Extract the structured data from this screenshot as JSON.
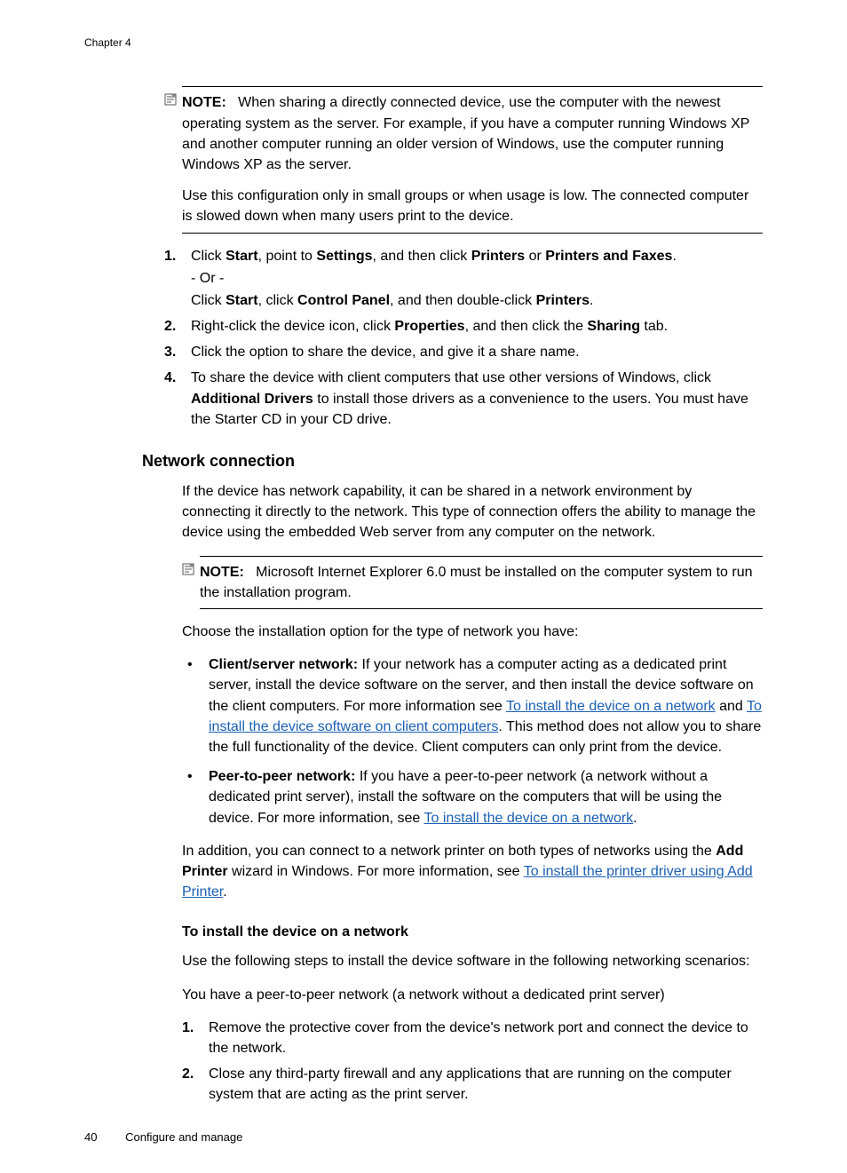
{
  "chapter": "Chapter 4",
  "note1": {
    "label": "NOTE:",
    "p1": "When sharing a directly connected device, use the computer with the newest operating system as the server. For example, if you have a computer running Windows XP and another computer running an older version of Windows, use the computer running Windows XP as the server.",
    "p2": "Use this configuration only in small groups or when usage is low. The connected computer is slowed down when many users print to the device."
  },
  "list1": {
    "i1a": "Click ",
    "i1b": "Start",
    "i1c": ", point to ",
    "i1d": "Settings",
    "i1e": ", and then click ",
    "i1f": "Printers",
    "i1g": " or ",
    "i1h": "Printers and Faxes",
    "i1i": ".",
    "i1or": "- Or -",
    "i1j": "Click ",
    "i1k": "Start",
    "i1l": ", click ",
    "i1m": "Control Panel",
    "i1n": ", and then double-click ",
    "i1o": "Printers",
    "i1p": ".",
    "i2a": "Right-click the device icon, click ",
    "i2b": "Properties",
    "i2c": ", and then click the ",
    "i2d": "Sharing",
    "i2e": " tab.",
    "i3": "Click the option to share the device, and give it a share name.",
    "i4a": "To share the device with client computers that use other versions of Windows, click ",
    "i4b": "Additional Drivers",
    "i4c": " to install those drivers as a convenience to the users. You must have the Starter CD in your CD drive."
  },
  "heading": "Network connection",
  "netIntro": "If the device has network capability, it can be shared in a network environment by connecting it directly to the network. This type of connection offers the ability to manage the device using the embedded Web server from any computer on the network.",
  "note2": {
    "label": "NOTE:",
    "p1": "Microsoft Internet Explorer 6.0 must be installed on the computer system to run the installation program."
  },
  "chooseLine": "Choose the installation option for the type of network you have:",
  "bullets": {
    "b1a": "Client/server network:",
    "b1b": " If your network has a computer acting as a dedicated print server, install the device software on the server, and then install the device software on the client computers. For more information see ",
    "b1link1": "To install the device on a network",
    "b1c": " and ",
    "b1link2": "To install the device software on client computers",
    "b1d": ". This method does not allow you to share the full functionality of the device. Client computers can only print from the device.",
    "b2a": "Peer-to-peer network:",
    "b2b": " If you have a peer-to-peer network (a network without a dedicated print server), install the software on the computers that will be using the device. For more information, see ",
    "b2link": "To install the device on a network",
    "b2c": "."
  },
  "addPrinter": {
    "a": "In addition, you can connect to a network printer on both types of networks using the ",
    "b": "Add Printer",
    "c": " wizard in Windows. For more information, see ",
    "link": "To install the printer driver using Add Printer",
    "d": "."
  },
  "subheading": "To install the device on a network",
  "subpara": "Use the following steps to install the device software in the following networking scenarios:",
  "p2pLine": "You have a peer-to-peer network (a network without a dedicated print server)",
  "list2": {
    "i1": "Remove the protective cover from the device's network port and connect the device to the network.",
    "i2": "Close any third-party firewall and any applications that are running on the computer system that are acting as the print server."
  },
  "footer": {
    "page": "40",
    "label": "Configure and manage"
  },
  "nums": {
    "n1": "1.",
    "n2": "2.",
    "n3": "3.",
    "n4": "4."
  }
}
